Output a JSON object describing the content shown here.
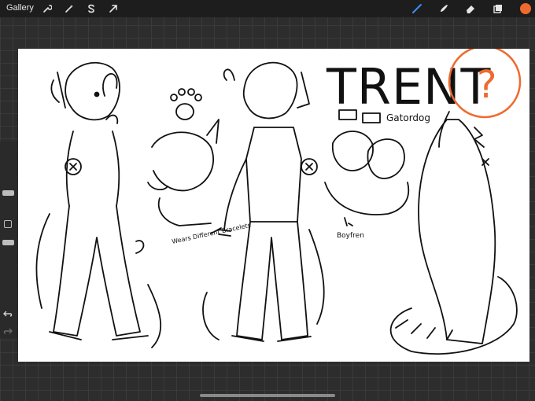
{
  "app": {
    "gallery_label": "Gallery"
  },
  "toolbar": {
    "left_tools": [
      "wrench-icon",
      "magic-wand-icon",
      "selection-icon",
      "transform-arrow-icon"
    ],
    "right_tools": [
      "brush-icon",
      "smudge-icon",
      "eraser-icon",
      "layers-icon",
      "color-icon"
    ],
    "active_tool": "brush-icon",
    "active_color": "#ef6a2e"
  },
  "sidebar": {
    "undo_icon": "undo-icon",
    "redo_icon": "redo-icon"
  },
  "artwork": {
    "title": "TRENT",
    "species": "Gatordog",
    "question_mark": "?",
    "note_bracelets": "Wears Different Bracelets",
    "note_boyfriend": "Boyfren",
    "ink_color": "#111111",
    "annotation_color": "#ef6a2e"
  }
}
